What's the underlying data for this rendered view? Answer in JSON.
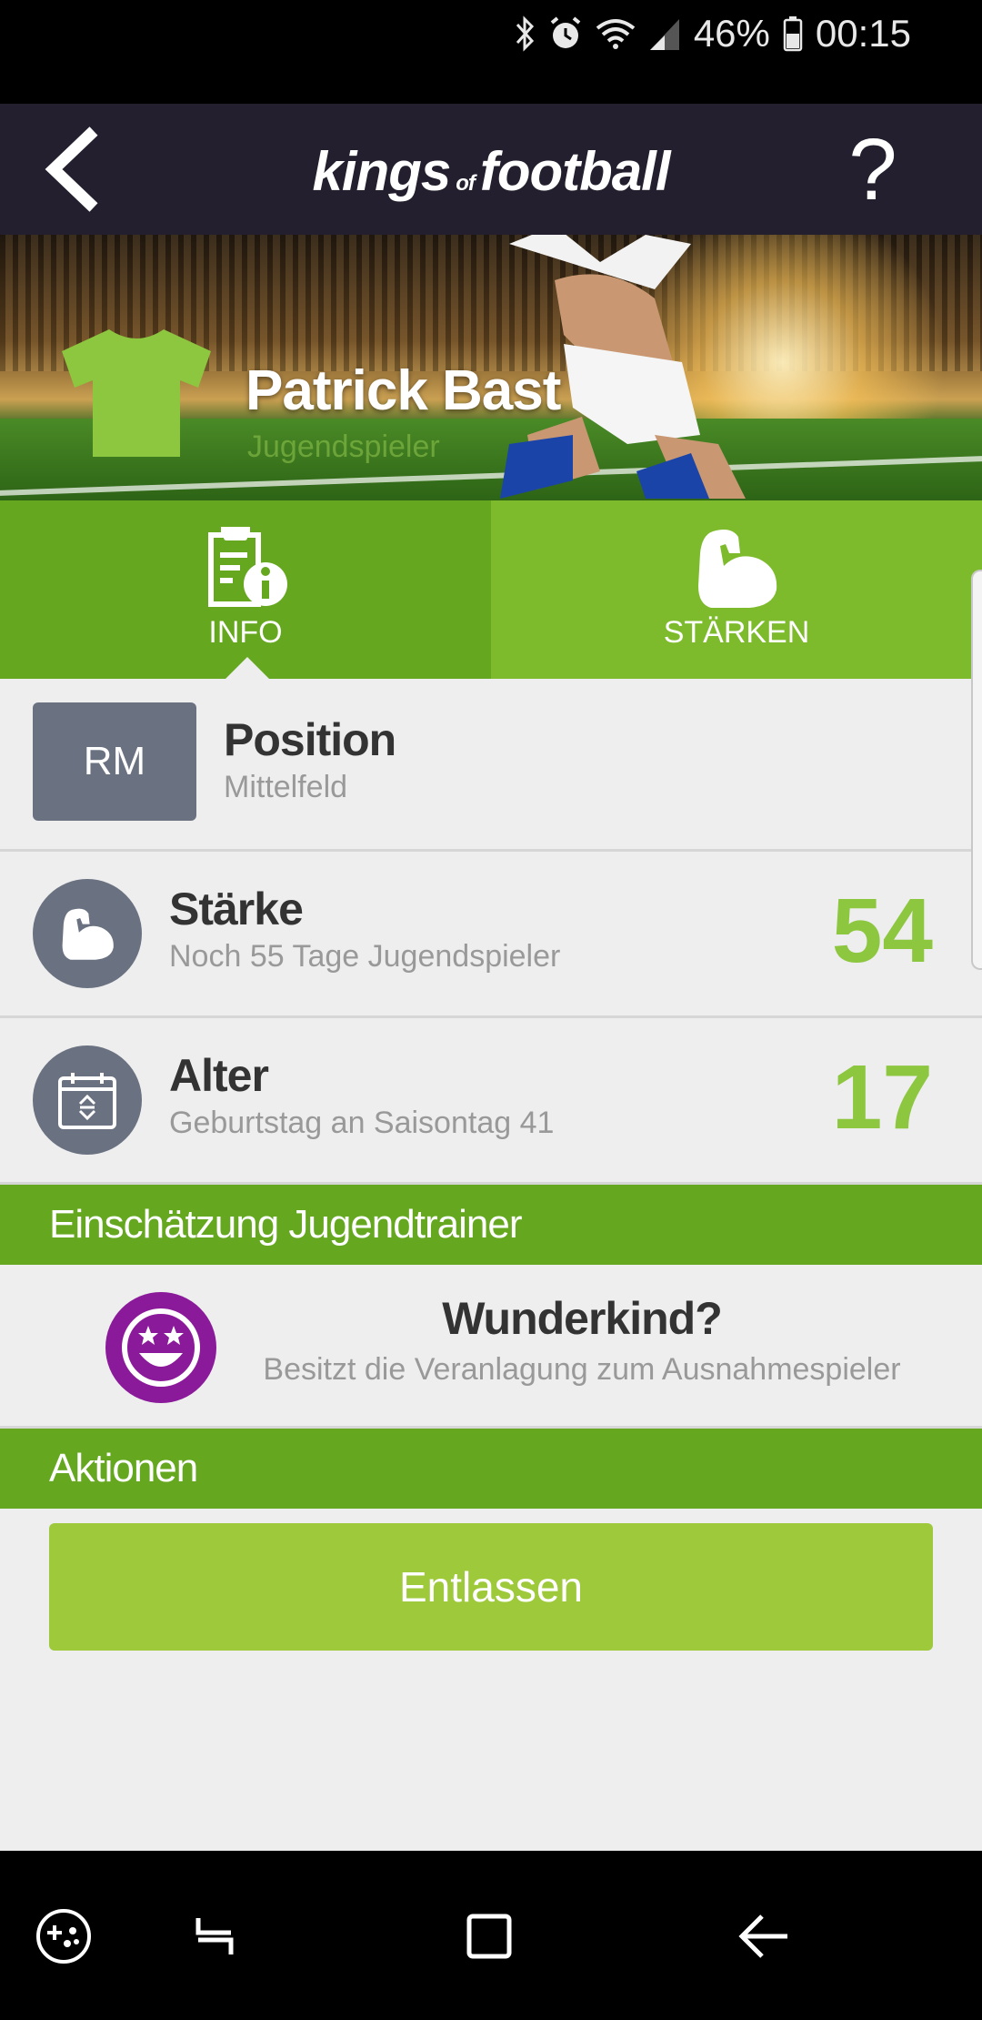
{
  "status_bar": {
    "battery_percent": "46%",
    "time": "00:15"
  },
  "header": {
    "logo_part1": "kings",
    "logo_of": "of",
    "logo_part2": "football",
    "help_label": "?"
  },
  "player": {
    "name": "Patrick Bast",
    "category": "Jugendspieler",
    "shirt_color": "#8dc63f"
  },
  "tabs": [
    {
      "label": "INFO",
      "icon": "info-document-icon",
      "active": true
    },
    {
      "label": "STÄRKEN",
      "icon": "flexed-arm-icon",
      "active": false
    }
  ],
  "position": {
    "abbr": "RM",
    "title": "Position",
    "value": "Mittelfeld"
  },
  "strength": {
    "title": "Stärke",
    "subtitle": "Noch 55 Tage Jugendspieler",
    "value": "54"
  },
  "age": {
    "title": "Alter",
    "subtitle": "Geburtstag an Saisontag 41",
    "value": "17"
  },
  "assessment": {
    "section_title": "Einschätzung Jugendtrainer",
    "title": "Wunderkind?",
    "subtitle": "Besitzt die Veranlagung zum Ausnahmespieler",
    "icon_color": "#8b1a9a"
  },
  "actions": {
    "section_title": "Aktionen",
    "dismiss_label": "Entlassen"
  },
  "colors": {
    "accent_green": "#65a820",
    "number_green": "#8dc63f",
    "header_bg": "#231f2e"
  }
}
